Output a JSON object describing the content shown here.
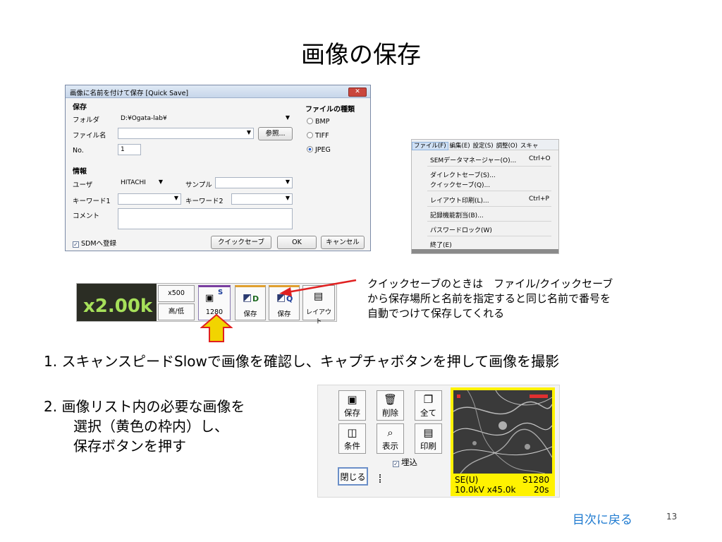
{
  "slide": {
    "title": "画像の保存",
    "toc_link": "目次に戻る",
    "page_number": "13"
  },
  "dialog": {
    "title": "画像に名前を付けて保存 [Quick Save]",
    "save_section": "保存",
    "folder_label": "フォルダ",
    "folder_value": "D:¥Ogata-lab¥",
    "filename_label": "ファイル名",
    "filename_value": "",
    "browse_button": "参照...",
    "no_label": "No.",
    "no_value": "1",
    "filetype_section": "ファイルの種類",
    "filetypes": [
      "BMP",
      "TIFF",
      "JPEG"
    ],
    "selected_filetype": "JPEG",
    "info_section": "情報",
    "user_label": "ユーザ",
    "user_value": "HITACHI",
    "sample_label": "サンプル",
    "sample_value": "",
    "keyword1_label": "キーワード1",
    "keyword2_label": "キーワード2",
    "comment_label": "コメント",
    "sdm_checkbox": "SDMへ登録",
    "sdm_checked": true,
    "quicksave_button": "クイックセーブ",
    "ok_button": "OK",
    "cancel_button": "キャンセル"
  },
  "menu": {
    "bar": [
      "ファイル(F)",
      "編集(E)",
      "設定(S)",
      "調整(O)",
      "スキャ"
    ],
    "items": [
      {
        "label": "SEMデータマネージャー(O)...",
        "shortcut": "Ctrl+O"
      },
      {
        "label": "ダイレクトセーブ(S)...",
        "shortcut": ""
      },
      {
        "label": "クイックセーブ(Q)...",
        "shortcut": ""
      },
      {
        "label": "レイアウト印刷(L)...",
        "shortcut": "Ctrl+P"
      },
      {
        "label": "記録機能割当(B)...",
        "shortcut": ""
      },
      {
        "label": "パスワードロック(W)",
        "shortcut": ""
      },
      {
        "label": "終了(E)",
        "shortcut": ""
      }
    ]
  },
  "toolbar": {
    "magnification": "x2.00k",
    "x500": "x500",
    "highlow": "高/低",
    "capture_res": "1280",
    "capture_badge": "S",
    "save_d": "保存",
    "save_q": "保存",
    "layout": "レイアウト"
  },
  "annotation": {
    "line1": "クイックセーブのときは　ファイル/クイックセーブ",
    "line2": "から保存場所と名前を指定すると同じ名前で番号を",
    "line3": "自動でつけて保存してくれる"
  },
  "steps": {
    "step1": "1. スキャンスピードSlowで画像を確認し、キャプチャボタンを押して画像を撮影",
    "step2_line1": "2. 画像リスト内の必要な画像を",
    "step2_line2": "選択（黄色の枠内）し、",
    "step2_line3": "保存ボタンを押す"
  },
  "image_panel": {
    "buttons": [
      "保存",
      "削除",
      "全て",
      "条件",
      "表示",
      "印刷"
    ],
    "embed_checkbox": "埋込",
    "embed_checked": true,
    "close_button": "閉じる",
    "thumb_line1_left": "SE(U)",
    "thumb_line1_right": "S1280",
    "thumb_line2_left": "10.0kV x45.0k",
    "thumb_line2_right": "20s"
  },
  "colors": {
    "link": "#1e7ad0",
    "mag_bg": "#2b2d24",
    "mag_text": "#a6e05a",
    "selection_yellow": "#fff200",
    "arrow_red": "#e02020",
    "highlight_arrow": "#f2d400"
  }
}
